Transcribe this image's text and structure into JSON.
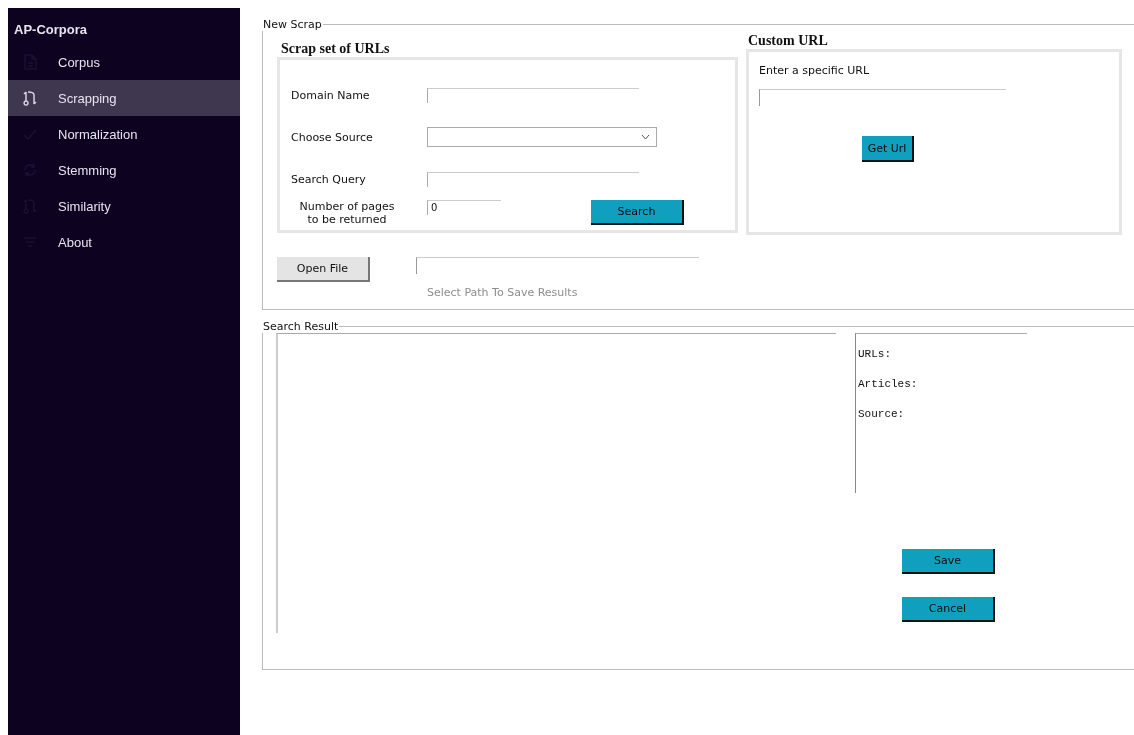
{
  "app": {
    "title": "AP-Corpora"
  },
  "sidebar": {
    "items": [
      {
        "label": "Corpus",
        "kind": "file",
        "selected": false
      },
      {
        "label": "Scrapping",
        "kind": "branch",
        "selected": true
      },
      {
        "label": "Normalization",
        "kind": "check",
        "selected": false
      },
      {
        "label": "Stemming",
        "kind": "sync",
        "selected": false
      },
      {
        "label": "Similarity",
        "kind": "branch",
        "selected": false
      },
      {
        "label": "About",
        "kind": "filter",
        "selected": false
      }
    ]
  },
  "new_scrap": {
    "legend": "New Scrap",
    "set_of_urls": {
      "heading": "Scrap set of URLs",
      "fields": [
        {
          "kind": "text",
          "label": "Domain Name"
        },
        {
          "kind": "select",
          "label": "Choose Source"
        },
        {
          "kind": "text",
          "label": "Search Query"
        },
        {
          "kind": "number",
          "label": "Number of pages\nto be returned",
          "value": "0"
        }
      ],
      "button": "Search"
    },
    "custom_url": {
      "heading": "Custom URL",
      "label": "Enter a specific URL",
      "button": "Get Url"
    },
    "open_file_button": "Open File",
    "path_hint": "Select Path To Save Results"
  },
  "search_result": {
    "legend": "Search Result",
    "stats": [
      "URLs:",
      "Articles:",
      "Source:"
    ],
    "buttons": [
      "Save",
      "Cancel"
    ]
  }
}
